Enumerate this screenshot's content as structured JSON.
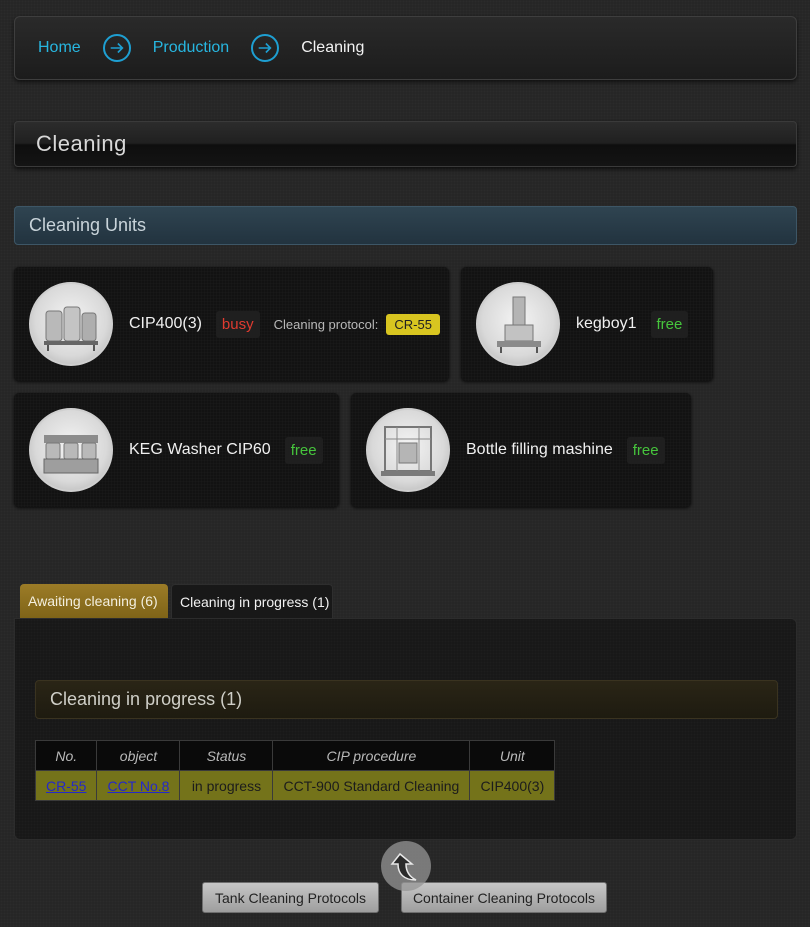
{
  "breadcrumb": {
    "items": [
      "Home",
      "Production"
    ],
    "current": "Cleaning"
  },
  "page_title": "Cleaning",
  "units_section": {
    "title": "Cleaning Units",
    "units": [
      {
        "name": "CIP400(3)",
        "status": "busy",
        "protocol_label": "Cleaning protocol:",
        "protocol": "CR-55"
      },
      {
        "name": "kegboy1",
        "status": "free"
      },
      {
        "name": "KEG Washer CIP60",
        "status": "free"
      },
      {
        "name": "Bottle filling mashine",
        "status": "free"
      }
    ]
  },
  "tabs": [
    {
      "label": "Awaiting cleaning (6)"
    },
    {
      "label": "Cleaning in progress (1)"
    }
  ],
  "panel": {
    "title": "Cleaning in progress (1)",
    "columns": [
      "No.",
      "object",
      "Status",
      "CIP procedure",
      "Unit"
    ],
    "rows": [
      [
        "CR-55",
        "CCT No.8",
        "in progress",
        "CCT-900 Standard Cleaning",
        "CIP400(3)"
      ]
    ]
  },
  "buttons": {
    "tank": "Tank Cleaning Protocols",
    "container": "Container Cleaning Protocols"
  },
  "colors": {
    "link": "#27b6e0",
    "busy": "#e03b30",
    "free": "#46c53c",
    "protocol_badge": "#d8c520",
    "tab_active": "#9c7c27",
    "row_bg": "#74731a"
  }
}
